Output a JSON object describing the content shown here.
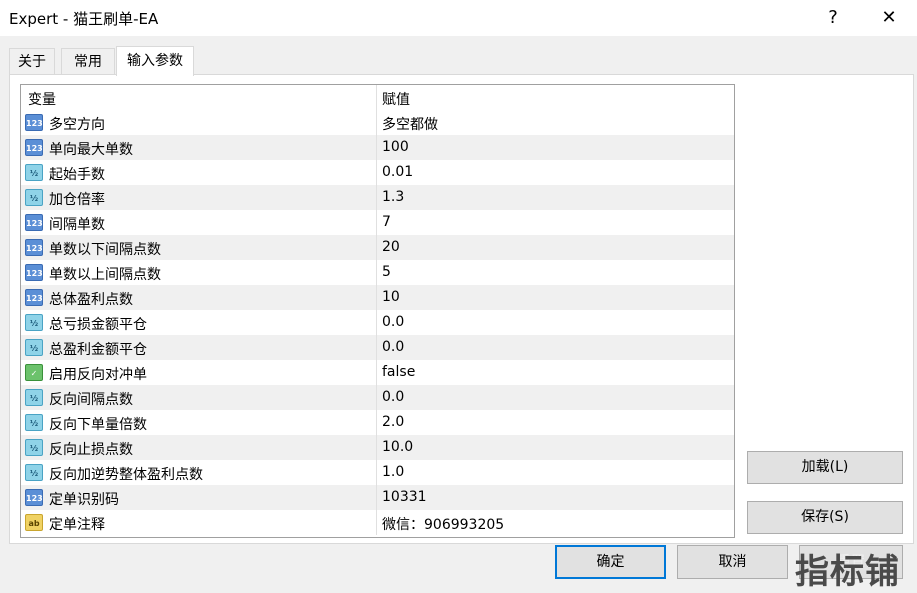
{
  "window": {
    "title": "Expert - 猫王刷单-EA",
    "help": "?",
    "close": "✕"
  },
  "tabs": [
    {
      "label": "关于"
    },
    {
      "label": "常用"
    },
    {
      "label": "输入参数"
    }
  ],
  "grid": {
    "col_variable": "变量",
    "col_value": "赋值",
    "rows": [
      {
        "icon": "123",
        "type": "int",
        "name": "多空方向",
        "value": "多空都做"
      },
      {
        "icon": "123",
        "type": "int",
        "name": "单向最大单数",
        "value": "100"
      },
      {
        "icon": "½",
        "type": "double",
        "name": "起始手数",
        "value": "0.01"
      },
      {
        "icon": "½",
        "type": "double",
        "name": "加仓倍率",
        "value": "1.3"
      },
      {
        "icon": "123",
        "type": "int",
        "name": "间隔单数",
        "value": "7"
      },
      {
        "icon": "123",
        "type": "int",
        "name": "单数以下间隔点数",
        "value": "20"
      },
      {
        "icon": "123",
        "type": "int",
        "name": "单数以上间隔点数",
        "value": "5"
      },
      {
        "icon": "123",
        "type": "int",
        "name": "总体盈利点数",
        "value": "10"
      },
      {
        "icon": "½",
        "type": "double",
        "name": "总亏损金额平仓",
        "value": "0.0"
      },
      {
        "icon": "½",
        "type": "double",
        "name": "总盈利金额平仓",
        "value": "0.0"
      },
      {
        "icon": "✓",
        "type": "bool",
        "name": "启用反向对冲单",
        "value": "false"
      },
      {
        "icon": "½",
        "type": "double",
        "name": "反向间隔点数",
        "value": "0.0"
      },
      {
        "icon": "½",
        "type": "double",
        "name": "反向下单量倍数",
        "value": "2.0"
      },
      {
        "icon": "½",
        "type": "double",
        "name": "反向止损点数",
        "value": "10.0"
      },
      {
        "icon": "½",
        "type": "double",
        "name": "反向加逆势整体盈利点数",
        "value": "1.0"
      },
      {
        "icon": "123",
        "type": "int",
        "name": "定单识别码",
        "value": "10331"
      },
      {
        "icon": "ab",
        "type": "string",
        "name": "定单注释",
        "value": "微信：906993205"
      }
    ]
  },
  "buttons": {
    "load": "加载(L)",
    "save": "保存(S)",
    "ok": "确定",
    "cancel": "取消",
    "reset": "重置"
  },
  "watermark": "指标铺"
}
